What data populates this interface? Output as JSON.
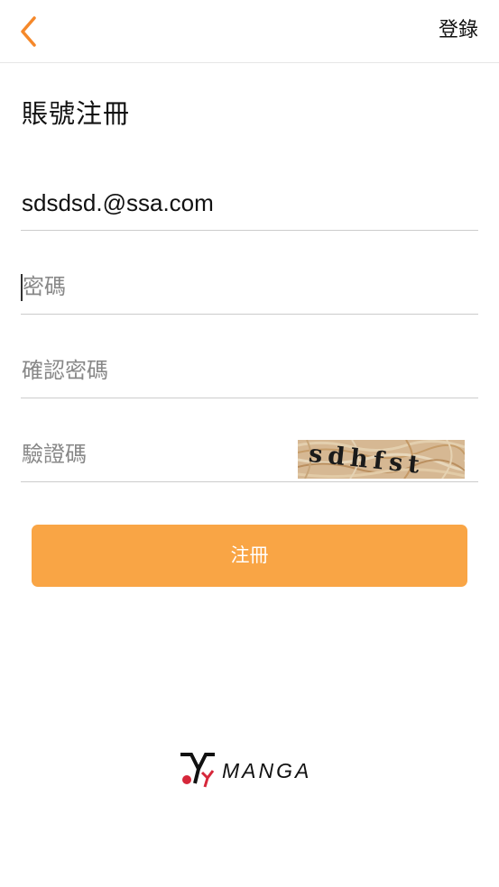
{
  "header": {
    "back_icon": "chevron-left-icon",
    "login_label": "登錄"
  },
  "page": {
    "title": "賬號注冊"
  },
  "form": {
    "email_value": "sdsdsd.@ssa.com",
    "password_placeholder": "密碼",
    "confirm_placeholder": "確認密碼",
    "captcha_placeholder": "驗證碼",
    "captcha_text": "sdhfst",
    "submit_label": "注冊"
  },
  "brand": {
    "logo_text": "MANGA",
    "logo_icon": "yy-logo-icon"
  },
  "colors": {
    "accent": "#f9a545",
    "back_arrow": "#f5882a",
    "logo_red": "#d6273a"
  }
}
